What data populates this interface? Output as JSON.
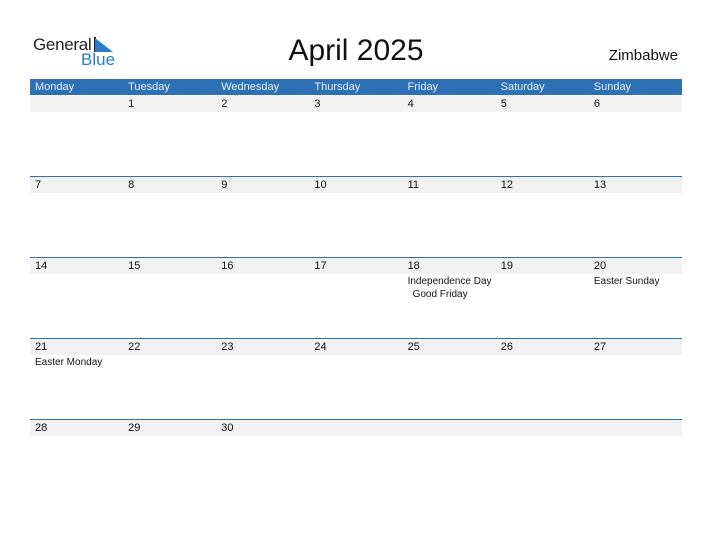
{
  "logo": {
    "line1": "General",
    "line2": "Blue"
  },
  "title": "April 2025",
  "country": "Zimbabwe",
  "colors": {
    "accent": "#2e70b4",
    "date_strip": "#f1f1f1",
    "logo_blue": "#2a7bc6"
  },
  "weekdays": [
    "Monday",
    "Tuesday",
    "Wednesday",
    "Thursday",
    "Friday",
    "Saturday",
    "Sunday"
  ],
  "weeks": [
    {
      "days": [
        {
          "num": "",
          "events": []
        },
        {
          "num": "1",
          "events": []
        },
        {
          "num": "2",
          "events": []
        },
        {
          "num": "3",
          "events": []
        },
        {
          "num": "4",
          "events": []
        },
        {
          "num": "5",
          "events": []
        },
        {
          "num": "6",
          "events": []
        }
      ]
    },
    {
      "days": [
        {
          "num": "7",
          "events": []
        },
        {
          "num": "8",
          "events": []
        },
        {
          "num": "9",
          "events": []
        },
        {
          "num": "10",
          "events": []
        },
        {
          "num": "11",
          "events": []
        },
        {
          "num": "12",
          "events": []
        },
        {
          "num": "13",
          "events": []
        }
      ]
    },
    {
      "days": [
        {
          "num": "14",
          "events": []
        },
        {
          "num": "15",
          "events": []
        },
        {
          "num": "16",
          "events": []
        },
        {
          "num": "17",
          "events": []
        },
        {
          "num": "18",
          "events": [
            "Independence Day",
            "Good Friday"
          ]
        },
        {
          "num": "19",
          "events": []
        },
        {
          "num": "20",
          "events": [
            "Easter Sunday"
          ]
        }
      ]
    },
    {
      "days": [
        {
          "num": "21",
          "events": [
            "Easter Monday"
          ]
        },
        {
          "num": "22",
          "events": []
        },
        {
          "num": "23",
          "events": []
        },
        {
          "num": "24",
          "events": []
        },
        {
          "num": "25",
          "events": []
        },
        {
          "num": "26",
          "events": []
        },
        {
          "num": "27",
          "events": []
        }
      ]
    },
    {
      "days": [
        {
          "num": "28",
          "events": []
        },
        {
          "num": "29",
          "events": []
        },
        {
          "num": "30",
          "events": []
        },
        {
          "num": "",
          "events": []
        },
        {
          "num": "",
          "events": []
        },
        {
          "num": "",
          "events": []
        },
        {
          "num": "",
          "events": []
        }
      ]
    }
  ]
}
